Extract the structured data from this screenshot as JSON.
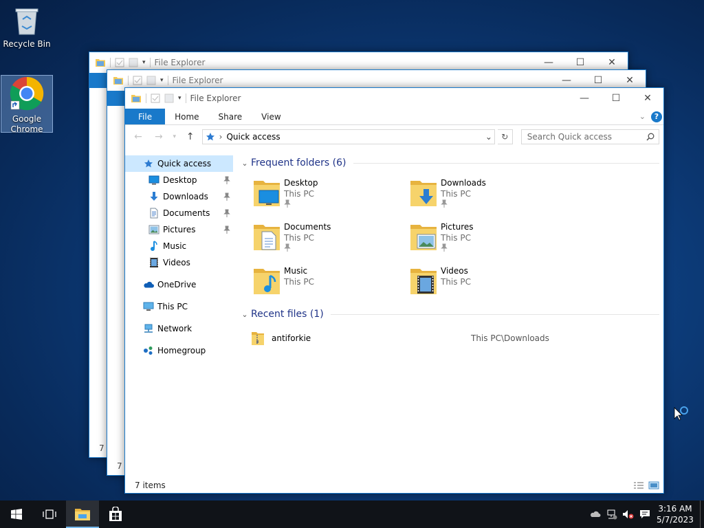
{
  "desktop": {
    "icons": [
      {
        "label": "Recycle Bin"
      },
      {
        "label": "Google Chrome"
      }
    ]
  },
  "background_windows": [
    {
      "title": "File Explorer",
      "status": "7 i"
    },
    {
      "title": "File Explorer",
      "status": "7 i"
    }
  ],
  "window": {
    "title": "File Explorer",
    "ribbon_tabs": [
      "File",
      "Home",
      "Share",
      "View"
    ],
    "address": {
      "current": "Quick access"
    },
    "search": {
      "placeholder": "Search Quick access"
    },
    "nav_pane": {
      "quick_access": "Quick access",
      "pinned": [
        "Desktop",
        "Downloads",
        "Documents",
        "Pictures"
      ],
      "unpinned": [
        "Music",
        "Videos"
      ],
      "onedrive": "OneDrive",
      "this_pc": "This PC",
      "network": "Network",
      "homegroup": "Homegroup"
    },
    "frequent_header": "Frequent folders (6)",
    "frequent_folders": [
      {
        "name": "Desktop",
        "location": "This PC"
      },
      {
        "name": "Downloads",
        "location": "This PC"
      },
      {
        "name": "Documents",
        "location": "This PC"
      },
      {
        "name": "Pictures",
        "location": "This PC"
      },
      {
        "name": "Music",
        "location": "This PC"
      },
      {
        "name": "Videos",
        "location": "This PC"
      }
    ],
    "recent_header": "Recent files (1)",
    "recent_files": [
      {
        "name": "antiforkie",
        "path": "This PC\\Downloads"
      }
    ],
    "status": "7 items"
  },
  "taskbar": {
    "time": "3:16 AM",
    "date": "5/7/2023"
  },
  "colors": {
    "accent": "#1979ca",
    "selection": "#cce8ff",
    "header_text": "#1e3287",
    "folder_yellow": "#f3c957"
  }
}
